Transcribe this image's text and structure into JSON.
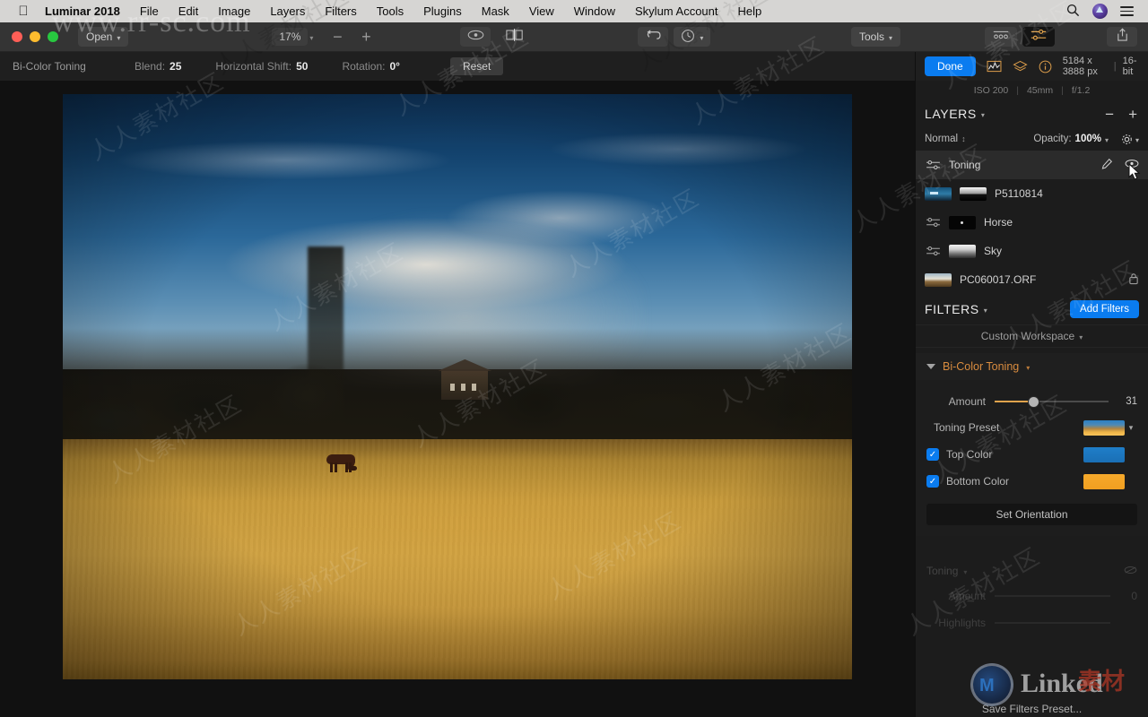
{
  "menubar": {
    "apple_icon": "apple-logo",
    "app_name": "Luminar 2018",
    "items": [
      "File",
      "Edit",
      "Image",
      "Layers",
      "Filters",
      "Tools",
      "Plugins",
      "Mask",
      "View",
      "Window",
      "Skylum Account",
      "Help"
    ],
    "right_icons": [
      "search-icon",
      "siri-icon",
      "control-center-icon"
    ]
  },
  "toolbar": {
    "open_label": "Open",
    "zoom_value": "17%",
    "zoom_out": "−",
    "zoom_in": "+",
    "preview_icon": "eye-icon",
    "compare_icon": "split-compare-icon",
    "undo_icon": "undo-arrow-icon",
    "history_icon": "history-clock-icon",
    "tools_label": "Tools",
    "presets_icon": "presets-filmstrip-icon",
    "adjust_icon": "adjust-sliders-icon",
    "share_icon": "share-export-icon"
  },
  "contextbar": {
    "title": "Bi-Color Toning",
    "fields": [
      {
        "label": "Blend:",
        "value": "25"
      },
      {
        "label": "Horizontal Shift:",
        "value": "50"
      },
      {
        "label": "Rotation:",
        "value": "0°"
      }
    ],
    "reset_label": "Reset"
  },
  "panel": {
    "done_label": "Done",
    "icons": [
      "histogram-icon",
      "layers-stack-icon",
      "info-icon"
    ],
    "image_size": "5184 x 3888 px",
    "bit_depth": "16-bit",
    "exif": [
      "ISO 200",
      "45mm",
      "f/1.2"
    ],
    "layers": {
      "title": "LAYERS",
      "remove_label": "−",
      "add_label": "+",
      "blend_mode": "Normal",
      "opacity_label": "Opacity:",
      "opacity_value": "100%",
      "gear_icon": "gear-icon",
      "items": [
        {
          "name": "Toning",
          "thumb": "adjustments-icon",
          "selected": true,
          "brush_icon": "brush-icon",
          "eye_icon": "eye-icon"
        },
        {
          "name": "P5110814",
          "thumb": "image-thumb",
          "mask": "mask-thumb",
          "selected": false
        },
        {
          "name": "Horse",
          "thumb": "adjustments-icon",
          "mask": "mask-dot-thumb",
          "selected": false
        },
        {
          "name": "Sky",
          "thumb": "adjustments-icon",
          "mask": "mask-sky-thumb",
          "selected": false
        },
        {
          "name": "PC060017.ORF",
          "thumb": "image-thumb",
          "locked": true,
          "lock_icon": "lock-icon",
          "selected": false
        }
      ]
    },
    "filters": {
      "title": "FILTERS",
      "add_label": "Add Filters",
      "workspace": "Custom Workspace",
      "active_filter": {
        "name": "Bi-Color Toning",
        "amount_label": "Amount",
        "amount_value": "31",
        "amount_percent": 34,
        "toning_preset_label": "Toning Preset",
        "top_color_label": "Top Color",
        "top_color_checked": true,
        "bottom_color_label": "Bottom Color",
        "bottom_color_checked": true,
        "set_orientation_label": "Set Orientation"
      },
      "dimmed_filter": {
        "name": "Toning",
        "amount_label": "Amount",
        "amount_value": "0",
        "highlights_label": "Highlights",
        "eye_icon": "eye-icon"
      },
      "save_preset_label": "Save Filters Preset..."
    }
  },
  "colors": {
    "accent_blue": "#0a7cf0",
    "accent_orange": "#d98c3f",
    "top_color": "#1f7ec9",
    "bottom_color": "#f6a92b",
    "panel_bg": "#1c1c1c",
    "menubar_bg": "#d6d5d3"
  },
  "watermarks": {
    "url": "www.rr-sc.com",
    "cn_text": "人人素材社区",
    "logo_text": "Linked",
    "logo_cn": "素材"
  }
}
